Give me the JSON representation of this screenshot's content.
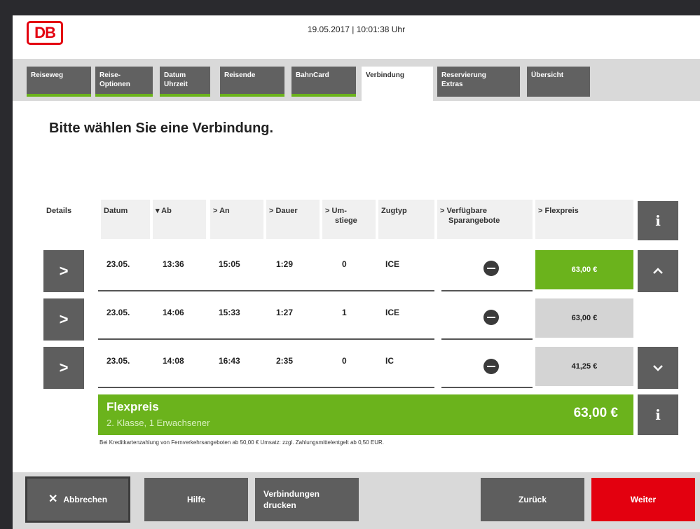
{
  "header": {
    "logo": "DB",
    "datetime": "19.05.2017 | 10:01:38 Uhr"
  },
  "tabs": [
    {
      "line1": "Reiseweg",
      "line2": ""
    },
    {
      "line1": "Reise-",
      "line2": "Optionen"
    },
    {
      "line1": "Datum",
      "line2": "Uhrzeit"
    },
    {
      "line1": "Reisende",
      "line2": ""
    },
    {
      "line1": "BahnCard",
      "line2": ""
    },
    {
      "line1": "Verbindung",
      "line2": ""
    },
    {
      "line1": "Reservierung",
      "line2": "Extras"
    },
    {
      "line1": "Übersicht",
      "line2": ""
    }
  ],
  "page_title": "Bitte wählen Sie eine Verbindung.",
  "columns": {
    "details": "Details",
    "datum": "Datum",
    "ab": "▾ Ab",
    "an": "> An",
    "dauer": "> Dauer",
    "umstiege_1": "> Um-",
    "umstiege_2": "stiege",
    "zugtyp": "Zugtyp",
    "spar_1": "> Verfügbare",
    "spar_2": "Sparangebote",
    "flexpreis": "> Flexpreis",
    "info": "i"
  },
  "rows": [
    {
      "datum": "23.05.",
      "ab": "13:36",
      "an": "15:05",
      "dauer": "1:29",
      "umstiege": "0",
      "zugtyp": "ICE",
      "preis": "63,00 €",
      "selected": true
    },
    {
      "datum": "23.05.",
      "ab": "14:06",
      "an": "15:33",
      "dauer": "1:27",
      "umstiege": "1",
      "zugtyp": "ICE",
      "preis": "63,00 €",
      "selected": false
    },
    {
      "datum": "23.05.",
      "ab": "14:08",
      "an": "16:43",
      "dauer": "2:35",
      "umstiege": "0",
      "zugtyp": "IC",
      "preis": "41,25 €",
      "selected": false
    }
  ],
  "row_button": ">",
  "summary": {
    "title": "Flexpreis",
    "subtitle": "2. Klasse, 1 Erwachsener",
    "price": "63,00 €",
    "info": "i"
  },
  "note": "Bei Kreditkartenzahlung von Fernverkehrsangeboten ab 50,00 € Umsatz: zzgl. Zahlungsmittelentgelt ab 0,50 EUR.",
  "footer": {
    "cancel": "Abbrechen",
    "cancel_icon": "✕",
    "help": "Hilfe",
    "print_1": "Verbindungen",
    "print_2": "drucken",
    "back": "Zurück",
    "next": "Weiter"
  },
  "colors": {
    "accent_green": "#6bb31c",
    "db_red": "#e3000f",
    "button_grey": "#5e5e5e"
  }
}
